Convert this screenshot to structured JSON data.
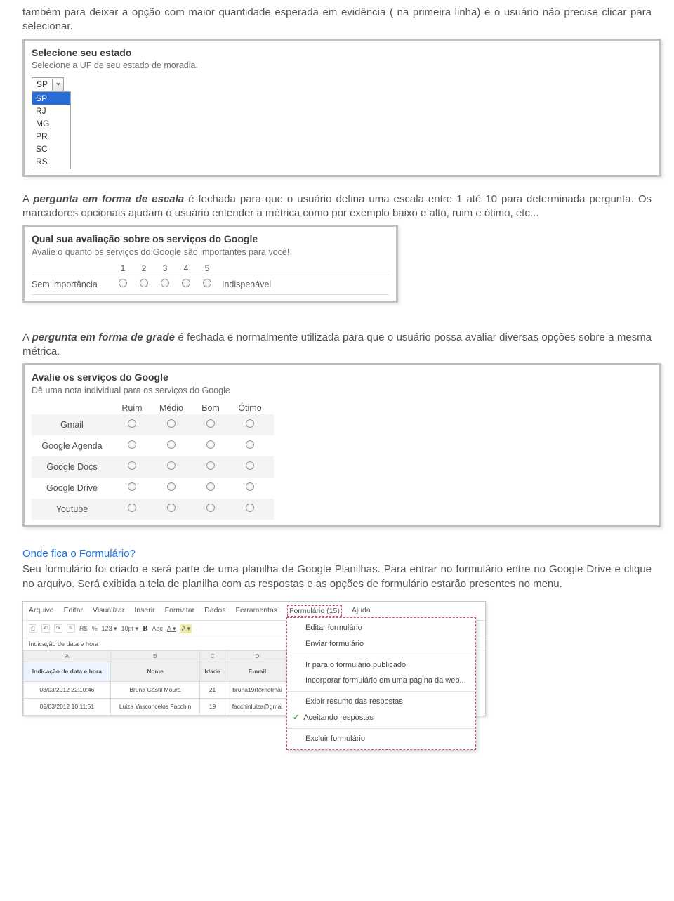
{
  "intro_text": "também para deixar a opção com maior quantidade esperada em evidência ( na primeira linha) e o usuário não precise clicar para selecionar.",
  "shot1": {
    "title": "Selecione seu estado",
    "sub": "Selecione a UF de seu estado de moradia.",
    "selected": "SP",
    "options": [
      "SP",
      "RJ",
      "MG",
      "PR",
      "SC",
      "RS"
    ]
  },
  "para2_lead": "pergunta em forma de escala",
  "para2_rest_a": "A ",
  "para2_rest_b": " é fechada para que o usuário defina uma escala entre 1 até 10 para determinada pergunta. Os marcadores opcionais ajudam o usuário entender a métrica como por exemplo baixo e alto, ruim e ótimo, etc...",
  "shot2": {
    "title": "Qual sua avaliação sobre os serviços do Google",
    "sub": "Avalie o quanto os serviços do Google são importantes para você!",
    "nums": [
      "1",
      "2",
      "3",
      "4",
      "5"
    ],
    "left": "Sem importância",
    "right": "Indispenável"
  },
  "para3_lead": "pergunta em forma de grade",
  "para3_rest_a": "A ",
  "para3_rest_b": " é fechada e normalmente utilizada para que o usuário possa avaliar diversas opções sobre a mesma métrica.",
  "shot3": {
    "title": "Avalie os serviços do Google",
    "sub": "Dê uma nota individual para os serviços do Google",
    "cols": [
      "Ruim",
      "Médio",
      "Bom",
      "Ótimo"
    ],
    "rows": [
      "Gmail",
      "Google Agenda",
      "Google Docs",
      "Google Drive",
      "Youtube"
    ]
  },
  "section_heading": "Onde fica o Formulário?",
  "para4": "Seu formulário foi criado e será parte de uma planilha de Google Planilhas. Para entrar no formulário entre no Google Drive e clique no arquivo. Será exibida a tela de planilha com as respostas e as opções de formulário estarão presentes no menu.",
  "shot4": {
    "menubar": [
      "Arquivo",
      "Editar",
      "Visualizar",
      "Inserir",
      "Formatar",
      "Dados",
      "Ferramentas"
    ],
    "menubar_form": "Formulário (15)",
    "menubar_help": "Ajuda",
    "toolbar": {
      "currency": "R$",
      "percent": "%",
      "numfmt": "123 ▾",
      "fontsize": "10pt ▾",
      "bold": "B",
      "strike": "Abc",
      "fgA": "A ▾",
      "bgA": "A ▾"
    },
    "namebox": "Indicação de data e hora",
    "table": {
      "colheads": [
        "A",
        "B",
        "C",
        "D"
      ],
      "header_row": [
        "Indicação de data e hora",
        "Nome",
        "Idade",
        "E-mail"
      ],
      "rows": [
        [
          "08/03/2012 22:10:46",
          "Bruna Gastil Moura",
          "21",
          "bruna19rt@hotmai"
        ],
        [
          "09/03/2012 10:11:51",
          "Luiza Vasconcelos Facchin",
          "19",
          "facchinluiza@gmai"
        ]
      ]
    },
    "menu": [
      {
        "label": "Editar formulário",
        "checked": false
      },
      {
        "label": "Enviar formulário",
        "checked": false
      },
      {
        "sep": true
      },
      {
        "label": "Ir para o formulário publicado",
        "checked": false
      },
      {
        "label": "Incorporar formulário em uma página da web...",
        "checked": false
      },
      {
        "sep": true
      },
      {
        "label": "Exibir resumo das respostas",
        "checked": false
      },
      {
        "label": "Aceitando respostas",
        "checked": true
      },
      {
        "sep": true
      },
      {
        "label": "Excluir formulário",
        "checked": false
      }
    ]
  }
}
